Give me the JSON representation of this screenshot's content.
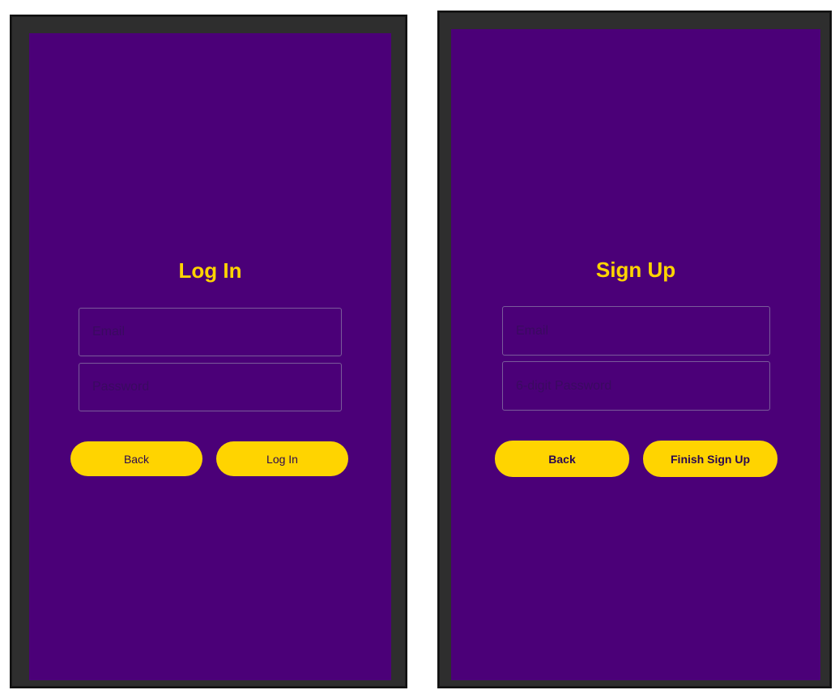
{
  "login_screen": {
    "title": "Log In",
    "email_placeholder": "Email",
    "password_placeholder": "Password",
    "back_label": "Back",
    "submit_label": "Log In"
  },
  "signup_screen": {
    "title": "Sign Up",
    "email_placeholder": "Email",
    "password_placeholder": "6-digit Password",
    "back_label": "Back",
    "submit_label": "Finish Sign Up"
  },
  "colors": {
    "background": "#4b0078",
    "accent": "#ffd400",
    "button_text": "#2a0850",
    "field_border": "#7a5b9a"
  }
}
